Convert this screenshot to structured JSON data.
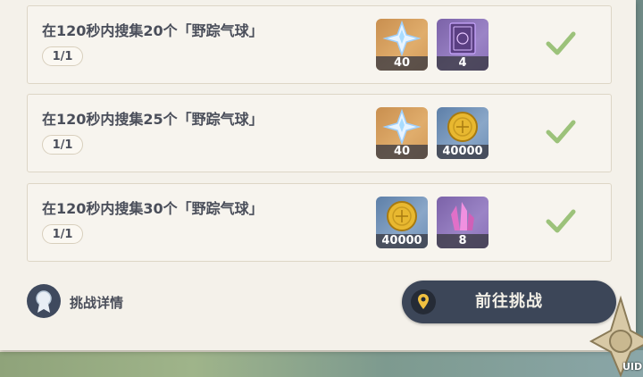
{
  "challenges": [
    {
      "title": "在120秒内搜集20个「野踪气球」",
      "progress": "1/1",
      "rewards": [
        {
          "icon": "primogem-icon",
          "count": "40"
        },
        {
          "icon": "hero-wit-book-icon",
          "count": "4"
        }
      ],
      "completed": true
    },
    {
      "title": "在120秒内搜集25个「野踪气球」",
      "progress": "1/1",
      "rewards": [
        {
          "icon": "primogem-icon",
          "count": "40"
        },
        {
          "icon": "mora-coin-icon",
          "count": "40000"
        }
      ],
      "completed": true
    },
    {
      "title": "在120秒内搜集30个「野踪气球」",
      "progress": "1/1",
      "rewards": [
        {
          "icon": "mora-coin-icon",
          "count": "40000"
        },
        {
          "icon": "mystic-ore-crystal-icon",
          "count": "8"
        }
      ],
      "completed": true
    }
  ],
  "footer": {
    "details_label": "挑战详情",
    "go_button_label": "前往挑战"
  },
  "overlay": {
    "uid_label": "UID"
  },
  "colors": {
    "check": "#9cc27a",
    "button": "#3c4658",
    "panel": "#f4f1ea",
    "pin": "#f0c040"
  }
}
